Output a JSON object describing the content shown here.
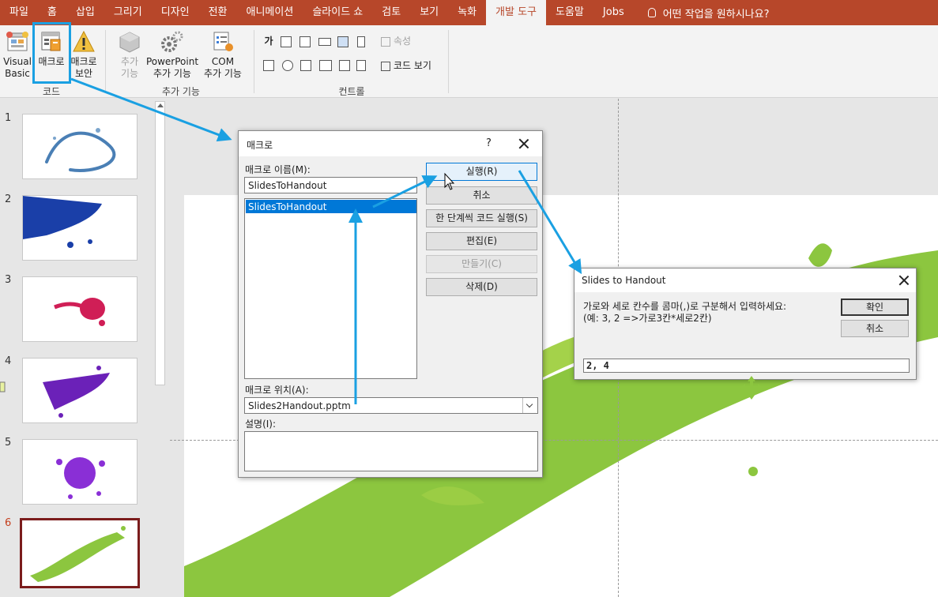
{
  "tabs": [
    "파일",
    "홈",
    "삽입",
    "그리기",
    "디자인",
    "전환",
    "애니메이션",
    "슬라이드 쇼",
    "검토",
    "보기",
    "녹화",
    "개발 도구",
    "도움말",
    "Jobs"
  ],
  "active_tab": "개발 도구",
  "tell_me": "어떤 작업을 원하시나요?",
  "ribbon": {
    "code_group": {
      "label": "코드",
      "visual_basic": [
        "Visual",
        "Basic"
      ],
      "macro": "매크로",
      "macro_security": [
        "매크로",
        "보안"
      ]
    },
    "addins_group": {
      "label": "추가 기능",
      "addins": [
        "추가",
        "기능"
      ],
      "ppt_addins": [
        "PowerPoint",
        "추가 기능"
      ],
      "com_addins": [
        "COM",
        "추가 기능"
      ]
    },
    "controls_group": {
      "label": "컨트롤",
      "properties": "속성",
      "view_code": "코드 보기",
      "label_glyph": "가",
      "textbox_glyph": "ㄱ|"
    }
  },
  "slides": [
    {
      "number": "1",
      "color": "#4a7fb5"
    },
    {
      "number": "2",
      "color": "#1a3fa8"
    },
    {
      "number": "3",
      "color": "#d01e56"
    },
    {
      "number": "4",
      "color": "#6b21b8"
    },
    {
      "number": "5",
      "color": "#8a2fd6"
    },
    {
      "number": "6",
      "color": "#8cc63f"
    }
  ],
  "active_slide": "6",
  "macro_dialog": {
    "title": "매크로",
    "help": "?",
    "name_label": "매크로 이름(M):",
    "name_value": "SlidesToHandout",
    "list_items": [
      "SlidesToHandout"
    ],
    "location_label": "매크로 위치(A):",
    "location_value": "Slides2Handout.pptm",
    "description_label": "설명(I):",
    "description_value": "",
    "buttons": {
      "run": "실행(R)",
      "cancel": "취소",
      "step_into": "한 단계씩 코드 실행(S)",
      "edit": "편집(E)",
      "create": "만들기(C)",
      "delete": "삭제(D)"
    }
  },
  "handout_dialog": {
    "title": "Slides to Handout",
    "prompt_line1": "가로와 세로 칸수를 콤마(,)로 구분해서 입력하세요:",
    "prompt_line2": "(예: 3, 2 =>가로3칸*세로2칸)",
    "ok": "확인",
    "cancel": "취소",
    "input_value": "2, 4"
  },
  "colors": {
    "accent": "#b7472a",
    "annotation": "#1aa0e2",
    "selection": "#0078d7",
    "splash_green": "#8cc63f"
  }
}
